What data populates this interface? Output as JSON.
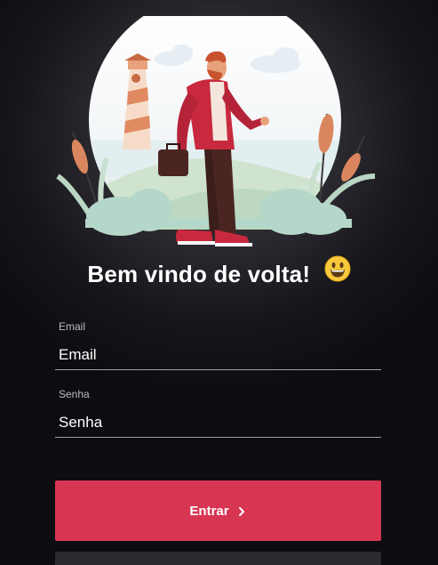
{
  "hero": {
    "image": "man-with-briefcase-by-lighthouse-illustration"
  },
  "welcome": {
    "title": "Bem vindo de volta!",
    "emoji": "😃"
  },
  "form": {
    "email": {
      "label": "Email",
      "placeholder": "Email",
      "value": ""
    },
    "password": {
      "label": "Senha",
      "placeholder": "Senha",
      "value": ""
    },
    "submit_label": "Entrar",
    "submit_icon": "chevron-right-icon"
  },
  "colors": {
    "background": "#0d0c11",
    "accent": "#d83553",
    "secondary_button": "#2b2a30",
    "input_underline": "#9d9ca3"
  }
}
